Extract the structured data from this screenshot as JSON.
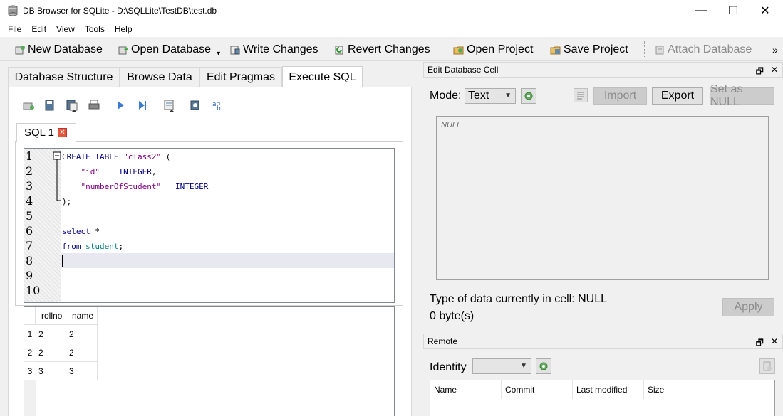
{
  "window": {
    "title": "DB Browser for SQLite - D:\\SQLLite\\TestDB\\test.db",
    "minimize": "—",
    "maximize": "☐",
    "close": "✕"
  },
  "menu": [
    "File",
    "Edit",
    "View",
    "Tools",
    "Help"
  ],
  "toolbar": {
    "new_database": "New Database",
    "open_database": "Open Database",
    "write_changes": "Write Changes",
    "revert_changes": "Revert Changes",
    "open_project": "Open Project",
    "save_project": "Save Project",
    "attach_database": "Attach Database",
    "overflow": "»"
  },
  "main_tabs": [
    "Database Structure",
    "Browse Data",
    "Edit Pragmas",
    "Execute SQL"
  ],
  "sql_tab": {
    "label": "SQL 1"
  },
  "editor": {
    "line_numbers": [
      "1",
      "2",
      "3",
      "4",
      "5",
      "6",
      "7",
      "8",
      "9",
      "10"
    ],
    "lines": {
      "l1_kw": "CREATE TABLE ",
      "l1_str": "\"class2\"",
      "l1_rest": " (",
      "l2_str": "\"id\"",
      "l2_kw": "INTEGER",
      "l2_rest": ",",
      "l3_str": "\"numberOfStudent\"",
      "l3_kw": "INTEGER",
      "l4": ");",
      "l6_kw": "select",
      "l6_rest": " *",
      "l7_kw": "from",
      "l7_id": "student",
      "l7_rest": ";"
    }
  },
  "results": {
    "columns": [
      "rollno",
      "name"
    ],
    "rows": [
      {
        "num": "1",
        "rollno": "2",
        "name": "2"
      },
      {
        "num": "2",
        "rollno": "2",
        "name": "2"
      },
      {
        "num": "3",
        "rollno": "3",
        "name": "3"
      }
    ]
  },
  "edit_cell": {
    "title": "Edit Database Cell",
    "mode_label": "Mode:",
    "mode_value": "Text",
    "import": "Import",
    "export": "Export",
    "set_null": "Set as NULL",
    "cell_value": "NULL",
    "type_info": "Type of data currently in cell: NULL",
    "size_info": "0 byte(s)",
    "apply": "Apply",
    "float_icon": "🗗",
    "close_icon": "✕"
  },
  "remote": {
    "title": "Remote",
    "identity_label": "Identity",
    "identity_value": "",
    "columns": [
      "Name",
      "Commit",
      "Last modified",
      "Size"
    ]
  }
}
